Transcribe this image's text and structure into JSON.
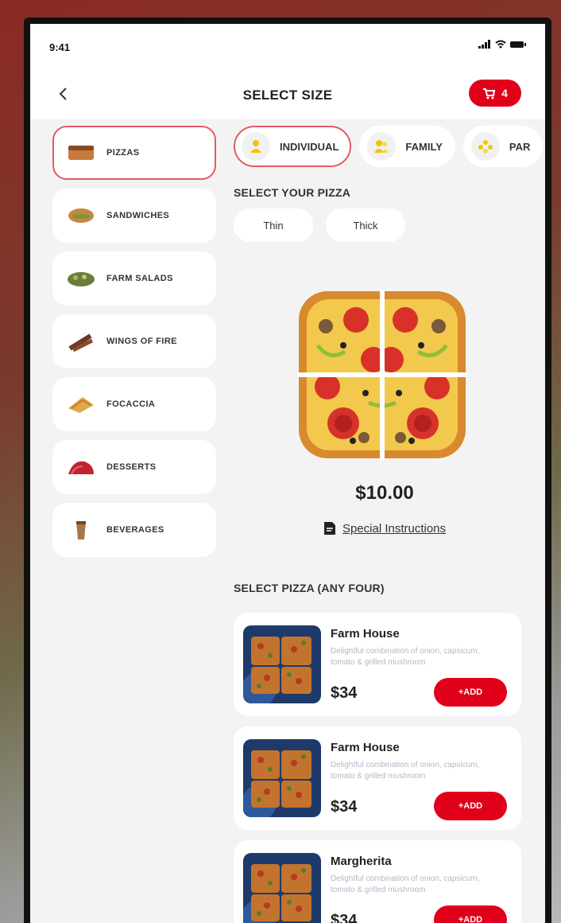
{
  "status": {
    "time": "9:41"
  },
  "header": {
    "title": "SELECT SIZE",
    "cart_count": "4"
  },
  "categories": [
    {
      "label": "PIZZAS",
      "active": true
    },
    {
      "label": "SANDWICHES"
    },
    {
      "label": "FARM SALADS"
    },
    {
      "label": "WINGS OF FIRE"
    },
    {
      "label": "FOCACCIA"
    },
    {
      "label": "DESSERTS"
    },
    {
      "label": "BEVERAGES"
    }
  ],
  "sizes": [
    {
      "label": "INDIVIDUAL",
      "active": true
    },
    {
      "label": "FAMILY"
    },
    {
      "label": "PAR"
    }
  ],
  "select_pizza_title": "SELECT YOUR PIZZA",
  "crusts": [
    "Thin",
    "Thick"
  ],
  "price": "$10.00",
  "special_instructions": "Special Instructions",
  "any_four_title": "SELECT PIZZA (ANY FOUR)",
  "products": [
    {
      "name": "Farm House",
      "description": "Delightful combination of onion, capsicum, tomato & grilled mushroom",
      "price": "$34",
      "add_label": "+ADD"
    },
    {
      "name": "Farm House",
      "description": "Delightful combination of onion, capsicum, tomato & grilled mushroom",
      "price": "$34",
      "add_label": "+ADD"
    },
    {
      "name": "Margherita",
      "description": "Delightful combination of onion, capsicum, tomato & grilled mushroom",
      "price": "$34",
      "add_label": "+ADD"
    }
  ],
  "colors": {
    "accent": "#e0001a",
    "active_border": "#e35a64",
    "background": "#f3f3f3"
  }
}
